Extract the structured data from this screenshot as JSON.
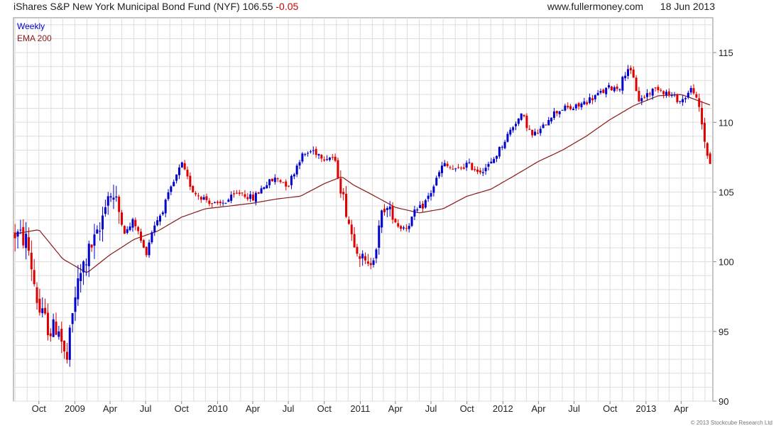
{
  "header": {
    "title": "iShares S&P New York Municipal Bond Fund (NYF)",
    "price": "106.55",
    "change": "-0.05",
    "site": "www.fullermoney.com",
    "date": "18 Jun 2013"
  },
  "legend": {
    "series1": "Weekly",
    "series2": "EMA 200"
  },
  "copyright": "© 2013 Stockcube Research Ltd",
  "colors": {
    "up": "#0000cc",
    "down": "#dd0000",
    "ema": "#8b1a1a",
    "grid": "#dddddd",
    "frame": "#888888"
  },
  "chart_data": {
    "type": "candlestick",
    "x_tick_labels": [
      "Oct",
      "2009",
      "Apr",
      "Jul",
      "Oct",
      "2010",
      "Apr",
      "Jul",
      "Oct",
      "2011",
      "Apr",
      "Jul",
      "Oct",
      "2012",
      "Apr",
      "Jul",
      "Oct",
      "2013",
      "Apr"
    ],
    "x_tick_dates": [
      "2008-10-01",
      "2009-01-01",
      "2009-04-01",
      "2009-07-01",
      "2009-10-01",
      "2010-01-01",
      "2010-04-01",
      "2010-07-01",
      "2010-10-01",
      "2011-01-01",
      "2011-04-01",
      "2011-07-01",
      "2011-10-01",
      "2012-01-01",
      "2012-04-01",
      "2012-07-01",
      "2012-10-01",
      "2013-01-01",
      "2013-04-01"
    ],
    "x_range": [
      "2008-07-28",
      "2013-06-21"
    ],
    "y_ticks": [
      90,
      95,
      100,
      105,
      110,
      115
    ],
    "ylim": [
      90,
      117.5
    ],
    "series": [
      {
        "name": "Weekly",
        "kind": "weekly close (approx.)",
        "points": [
          [
            "2008-08-01",
            102.0
          ],
          [
            "2008-09-01",
            101.5
          ],
          [
            "2008-10-01",
            96.5
          ],
          [
            "2008-11-01",
            95.0
          ],
          [
            "2008-11-20",
            95.5
          ],
          [
            "2008-12-10",
            92.5
          ],
          [
            "2009-01-01",
            97.5
          ],
          [
            "2009-01-20",
            99.5
          ],
          [
            "2009-02-10",
            101.0
          ],
          [
            "2009-03-05",
            102.0
          ],
          [
            "2009-03-20",
            104.5
          ],
          [
            "2009-04-01",
            105.0
          ],
          [
            "2009-04-20",
            104.0
          ],
          [
            "2009-05-10",
            102.0
          ],
          [
            "2009-06-01",
            103.0
          ],
          [
            "2009-07-01",
            100.5
          ],
          [
            "2009-07-20",
            102.5
          ],
          [
            "2009-08-10",
            103.5
          ],
          [
            "2009-09-01",
            105.0
          ],
          [
            "2009-10-01",
            107.0
          ],
          [
            "2009-10-15",
            106.0
          ],
          [
            "2009-11-01",
            105.0
          ],
          [
            "2009-12-01",
            104.5
          ],
          [
            "2010-01-01",
            104.0
          ],
          [
            "2010-02-01",
            104.5
          ],
          [
            "2010-03-01",
            105.0
          ],
          [
            "2010-04-01",
            104.5
          ],
          [
            "2010-05-01",
            105.5
          ],
          [
            "2010-06-01",
            106.0
          ],
          [
            "2010-07-01",
            105.5
          ],
          [
            "2010-08-01",
            107.5
          ],
          [
            "2010-09-01",
            108.0
          ],
          [
            "2010-10-01",
            107.5
          ],
          [
            "2010-10-25",
            107.5
          ],
          [
            "2010-11-15",
            105.0
          ],
          [
            "2010-12-10",
            102.0
          ],
          [
            "2011-01-01",
            100.5
          ],
          [
            "2011-01-20",
            99.5
          ],
          [
            "2011-02-10",
            101.0
          ],
          [
            "2011-03-01",
            104.0
          ],
          [
            "2011-03-20",
            103.5
          ],
          [
            "2011-04-10",
            102.5
          ],
          [
            "2011-05-01",
            102.5
          ],
          [
            "2011-05-20",
            103.5
          ],
          [
            "2011-06-10",
            104.0
          ],
          [
            "2011-07-01",
            105.0
          ],
          [
            "2011-08-01",
            107.0
          ],
          [
            "2011-09-01",
            106.5
          ],
          [
            "2011-10-01",
            107.0
          ],
          [
            "2011-11-01",
            106.5
          ],
          [
            "2011-12-01",
            107.0
          ],
          [
            "2012-01-01",
            108.5
          ],
          [
            "2012-02-01",
            110.0
          ],
          [
            "2012-02-20",
            110.5
          ],
          [
            "2012-03-15",
            109.0
          ],
          [
            "2012-04-10",
            109.5
          ],
          [
            "2012-05-01",
            110.5
          ],
          [
            "2012-06-01",
            111.0
          ],
          [
            "2012-07-01",
            111.0
          ],
          [
            "2012-08-01",
            111.5
          ],
          [
            "2012-09-01",
            112.0
          ],
          [
            "2012-10-01",
            112.5
          ],
          [
            "2012-10-25",
            112.5
          ],
          [
            "2012-11-15",
            114.0
          ],
          [
            "2012-12-01",
            113.0
          ],
          [
            "2012-12-15",
            111.5
          ],
          [
            "2013-01-01",
            112.0
          ],
          [
            "2013-02-01",
            112.5
          ],
          [
            "2013-03-01",
            112.0
          ],
          [
            "2013-04-01",
            111.5
          ],
          [
            "2013-05-01",
            112.5
          ],
          [
            "2013-05-20",
            110.5
          ],
          [
            "2013-06-01",
            108.5
          ],
          [
            "2013-06-18",
            106.55
          ]
        ]
      },
      {
        "name": "EMA 200",
        "points": [
          [
            "2008-08-01",
            102.0
          ],
          [
            "2008-10-01",
            102.3
          ],
          [
            "2008-12-01",
            100.2
          ],
          [
            "2009-02-01",
            99.2
          ],
          [
            "2009-04-01",
            100.5
          ],
          [
            "2009-06-01",
            101.6
          ],
          [
            "2009-08-01",
            102.2
          ],
          [
            "2009-10-01",
            103.2
          ],
          [
            "2009-12-01",
            103.8
          ],
          [
            "2010-02-01",
            104.0
          ],
          [
            "2010-04-01",
            104.2
          ],
          [
            "2010-06-01",
            104.5
          ],
          [
            "2010-08-01",
            104.7
          ],
          [
            "2010-10-01",
            105.6
          ],
          [
            "2010-11-15",
            106.1
          ],
          [
            "2010-12-15",
            105.5
          ],
          [
            "2011-02-01",
            104.8
          ],
          [
            "2011-04-01",
            103.9
          ],
          [
            "2011-06-01",
            103.5
          ],
          [
            "2011-08-01",
            103.8
          ],
          [
            "2011-10-01",
            104.7
          ],
          [
            "2011-12-01",
            105.2
          ],
          [
            "2012-02-01",
            106.2
          ],
          [
            "2012-04-01",
            107.2
          ],
          [
            "2012-06-01",
            108.0
          ],
          [
            "2012-08-01",
            109.0
          ],
          [
            "2012-10-01",
            110.2
          ],
          [
            "2012-12-01",
            111.2
          ],
          [
            "2013-02-01",
            111.9
          ],
          [
            "2013-04-01",
            112.0
          ],
          [
            "2013-06-18",
            111.2
          ]
        ]
      }
    ],
    "grid": true,
    "legend_position": "top-left"
  }
}
